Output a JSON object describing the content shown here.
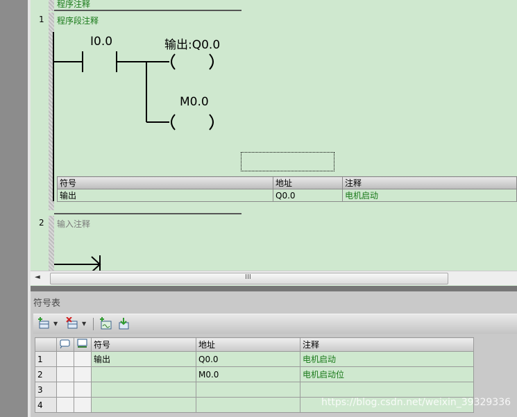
{
  "editor": {
    "title_comment": "程序注释",
    "network1": {
      "number": "1",
      "comment": "程序段注释",
      "contact_address": "I0.0",
      "coil1_label": "输出:Q0.0",
      "coil2_label": "M0.0",
      "info_table": {
        "headers": [
          "符号",
          "地址",
          "注释"
        ],
        "row": [
          "输出",
          "Q0.0",
          "电机启动"
        ]
      }
    },
    "network2": {
      "number": "2",
      "comment": "输入注释"
    },
    "scrollbar": {
      "left_arrow": "◄",
      "grip": "III"
    }
  },
  "symbol_table": {
    "title": "符号表",
    "headers": [
      "",
      "",
      "",
      "符号",
      "地址",
      "注释"
    ],
    "rows": [
      {
        "num": "1",
        "symbol": "输出",
        "address": "Q0.0",
        "comment": "电机启动"
      },
      {
        "num": "2",
        "symbol": "",
        "address": "M0.0",
        "comment": "电机启动位"
      },
      {
        "num": "3",
        "symbol": "",
        "address": "",
        "comment": ""
      },
      {
        "num": "4",
        "symbol": "",
        "address": "",
        "comment": ""
      }
    ]
  },
  "watermark": "https://blog.csdn.net/weixin_39329336",
  "colors": {
    "background": "#cfe8cf",
    "comment_green": "#1a7a1a"
  }
}
